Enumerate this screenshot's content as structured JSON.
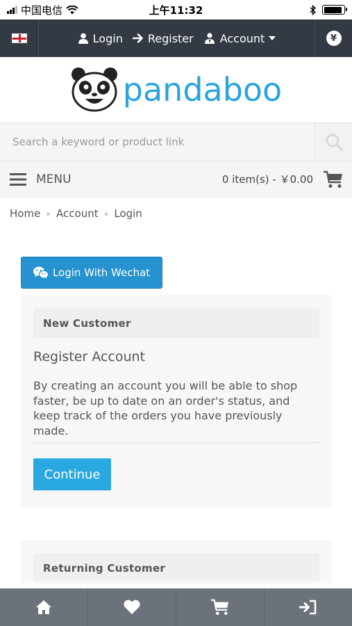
{
  "status_bar": {
    "carrier": "中国电信",
    "time": "上午11:32"
  },
  "top_nav": {
    "login": "Login",
    "register": "Register",
    "account": "Account",
    "currency_symbol": "¥"
  },
  "logo": {
    "text": "pandaboo"
  },
  "search": {
    "placeholder": "Search a keyword or product link"
  },
  "menu_bar": {
    "menu_label": "MENU",
    "cart_summary": "0 item(s) - ￥0.00"
  },
  "breadcrumb": {
    "items": [
      "Home",
      "Account",
      "Login"
    ],
    "separator": "»"
  },
  "wechat_button": {
    "label": "Login With Wechat"
  },
  "new_customer": {
    "heading": "New Customer",
    "title": "Register Account",
    "description": "By creating an account you will be able to shop faster, be up to date on an order's status, and keep track of the orders you have previously made.",
    "continue_label": "Continue"
  },
  "returning_customer": {
    "heading": "Returning Customer"
  },
  "bottom_nav": {
    "icons": [
      "home-icon",
      "heart-icon",
      "cart-icon",
      "sign-in-icon"
    ]
  },
  "colors": {
    "top_nav_bg": "#333a44",
    "brand_blue": "#2aa4dc",
    "wechat_button": "#2692cf",
    "continue_button": "#2aa9e0",
    "bottom_nav_bg": "#6b7279"
  }
}
